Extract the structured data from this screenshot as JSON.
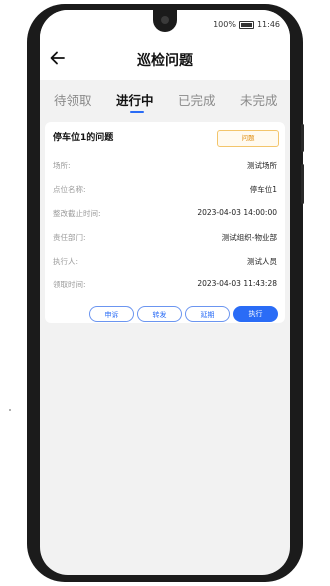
{
  "status_bar": {
    "battery": "100%",
    "time": "11:46"
  },
  "header": {
    "title": "巡检问题"
  },
  "tabs": [
    {
      "label": "待领取"
    },
    {
      "label": "进行中"
    },
    {
      "label": "已完成"
    },
    {
      "label": "未完成"
    }
  ],
  "active_tab": "进行中",
  "card": {
    "title": "停车位1的问题",
    "tag": "问题",
    "rows": [
      {
        "label": "场所:",
        "value": "测试场所"
      },
      {
        "label": "点位名称:",
        "value": "停车位1"
      },
      {
        "label": "整改截止时间:",
        "value": "2023-04-03 14:00:00"
      },
      {
        "label": "责任部门:",
        "value": "测试组织-物业部"
      },
      {
        "label": "执行人:",
        "value": "测试人员"
      },
      {
        "label": "领取时间:",
        "value": "2023-04-03 11:43:28"
      }
    ],
    "actions": {
      "appeal": "申诉",
      "transfer": "转发",
      "extend": "延期",
      "execute": "执行"
    }
  },
  "colors": {
    "accent": "#2a6cf6",
    "tag_border": "#f3c56b",
    "tag_text": "#e08f12"
  },
  "icons": [
    "back-arrow-icon",
    "camera-icon",
    "battery-icon"
  ]
}
